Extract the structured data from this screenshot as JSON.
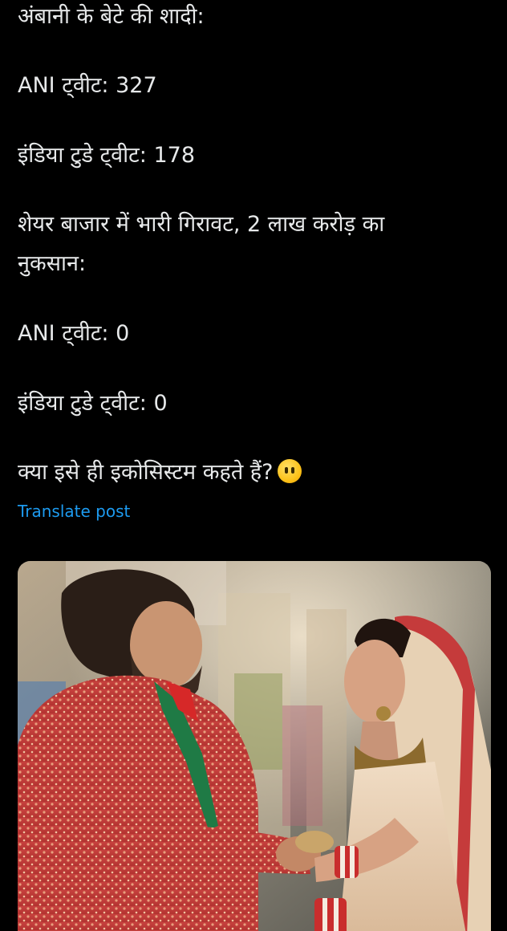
{
  "post": {
    "lines": [
      "अंबानी के बेटे की शादी:",
      "ANI ट्वीट: 327",
      "इंडिया टुडे ट्वीट: 178",
      "शेयर बाजार में भारी गिरावट, 2 लाख करोड़ का",
      "नुकसान:",
      "ANI ट्वीट: 0",
      "इंडिया टुडे ट्वीट: 0",
      "क्या इसे ही इकोसिस्टम कहते हैं?"
    ],
    "emoji": "no-mouth-face-emoji",
    "translate_label": "Translate post"
  },
  "media": {
    "description_icon": "wedding-photo"
  },
  "colors": {
    "background": "#000000",
    "text": "#e7e9ea",
    "link": "#1d9bf0"
  }
}
